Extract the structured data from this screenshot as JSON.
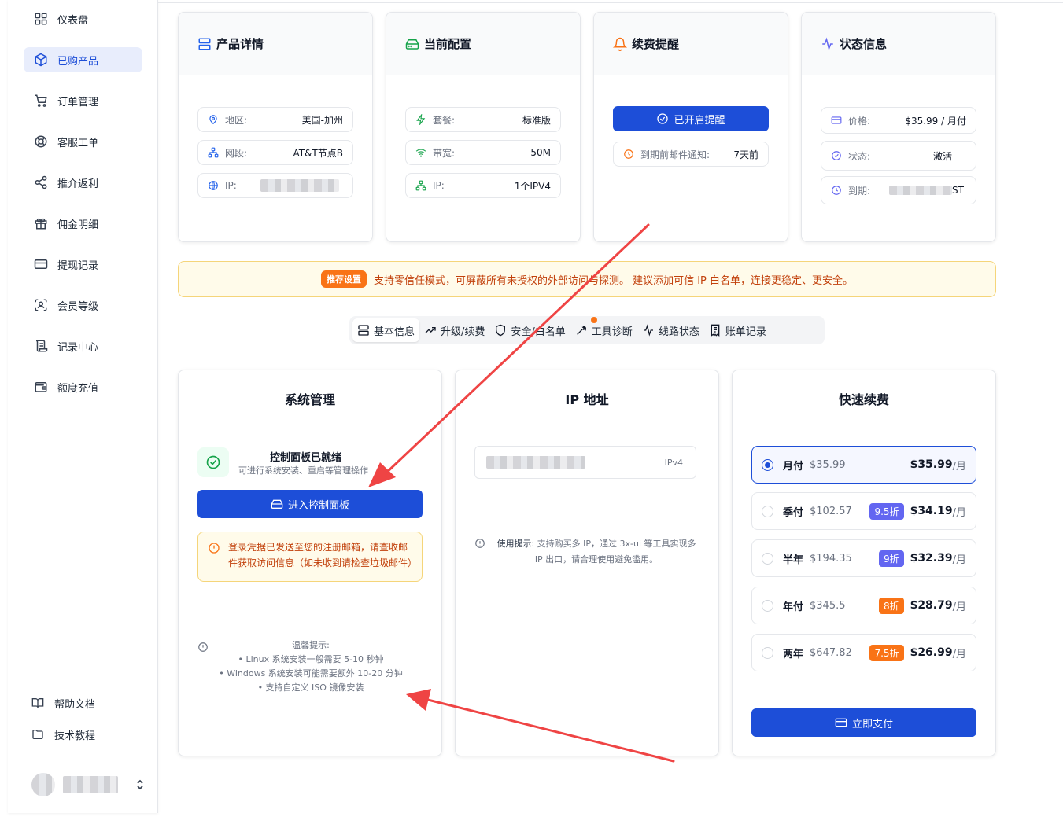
{
  "sidebar": {
    "items": [
      {
        "label": "仪表盘",
        "icon": "grid-icon"
      },
      {
        "label": "已购产品",
        "icon": "box-icon",
        "active": true
      },
      {
        "label": "订单管理",
        "icon": "cart-icon"
      },
      {
        "label": "客服工单",
        "icon": "lifebuoy-icon"
      },
      {
        "label": "推介返利",
        "icon": "share-icon"
      },
      {
        "label": "佣金明细",
        "icon": "gift-icon"
      },
      {
        "label": "提现记录",
        "icon": "card-icon"
      },
      {
        "label": "会员等级",
        "icon": "scan-user-icon"
      },
      {
        "label": "记录中心",
        "icon": "scroll-icon"
      },
      {
        "label": "额度充值",
        "icon": "wallet-icon"
      }
    ],
    "footer": [
      {
        "label": "帮助文档",
        "icon": "book-icon"
      },
      {
        "label": "技术教程",
        "icon": "folder-icon"
      }
    ]
  },
  "cards": {
    "product": {
      "title": "产品详情",
      "rows": [
        {
          "label": "地区:",
          "value": "美国-加州"
        },
        {
          "label": "网段:",
          "value": "AT&T节点B"
        },
        {
          "label": "IP:",
          "value": ""
        }
      ]
    },
    "config": {
      "title": "当前配置",
      "rows": [
        {
          "label": "套餐:",
          "value": "标准版"
        },
        {
          "label": "带宽:",
          "value": "50M"
        },
        {
          "label": "IP:",
          "value": "1个IPV4"
        }
      ]
    },
    "renew": {
      "title": "续费提醒",
      "button": "已开启提醒",
      "notice_label": "到期前邮件通知:",
      "notice_value": "7天前"
    },
    "status": {
      "title": "状态信息",
      "rows": [
        {
          "label": "价格:",
          "value": "$35.99 / 月付"
        },
        {
          "label": "状态:",
          "value": "激活"
        },
        {
          "label": "到期:",
          "value": "ST"
        }
      ]
    }
  },
  "banner": {
    "tag": "推荐设置",
    "text": "支持零信任模式，可屏蔽所有未授权的外部访问与探测。 建议添加可信 IP 白名单，连接更稳定、更安全。"
  },
  "tabs": [
    {
      "label": "基本信息",
      "icon": "server-icon",
      "active": true
    },
    {
      "label": "升级/续费",
      "icon": "trending-up-icon"
    },
    {
      "label": "安全/白名单",
      "icon": "shield-icon"
    },
    {
      "label": "工具诊断",
      "icon": "wrench-icon"
    },
    {
      "label": "线路状态",
      "icon": "activity-icon"
    },
    {
      "label": "账单记录",
      "icon": "receipt-icon"
    }
  ],
  "system": {
    "title": "系统管理",
    "ready_title": "控制面板已就绪",
    "ready_desc": "可进行系统安装、重启等管理操作",
    "button": "进入控制面板",
    "warning": "登录凭据已发送至您的注册邮箱，请查收邮件获取访问信息（如未收到请检查垃圾邮件）",
    "tips_title": "温馨提示:",
    "tips": [
      "• Linux 系统安装一般需要 5-10 秒钟",
      "• Windows 系统安装可能需要额外 10-20 分钟",
      "• 支持自定义 ISO 镜像安装"
    ]
  },
  "ip": {
    "title": "IP 地址",
    "type": "IPv4",
    "hint_label": "使用提示:",
    "hint": "支持购买多 IP，通过 3x-ui 等工具实现多 IP 出口，请合理使用避免滥用。"
  },
  "renew_plans": {
    "title": "快速续费",
    "plans": [
      {
        "name": "月付",
        "orig": "$35.99",
        "discount": "",
        "price": "$35.99",
        "unit": "/月",
        "selected": true
      },
      {
        "name": "季付",
        "orig": "$102.57",
        "discount": "9.5折",
        "disc_color": "#6366f1",
        "price": "$34.19",
        "unit": "/月"
      },
      {
        "name": "半年",
        "orig": "$194.35",
        "discount": "9折",
        "disc_color": "#6366f1",
        "price": "$32.39",
        "unit": "/月"
      },
      {
        "name": "年付",
        "orig": "$345.5",
        "discount": "8折",
        "disc_color": "#f97316",
        "price": "$28.79",
        "unit": "/月"
      },
      {
        "name": "两年",
        "orig": "$647.82",
        "discount": "7.5折",
        "disc_color": "#f97316",
        "price": "$26.99",
        "unit": "/月"
      }
    ],
    "pay_button": "立即支付"
  },
  "colors": {
    "primary": "#1d4ed8",
    "warning": "#f97316",
    "annotation": "#ef4444"
  }
}
